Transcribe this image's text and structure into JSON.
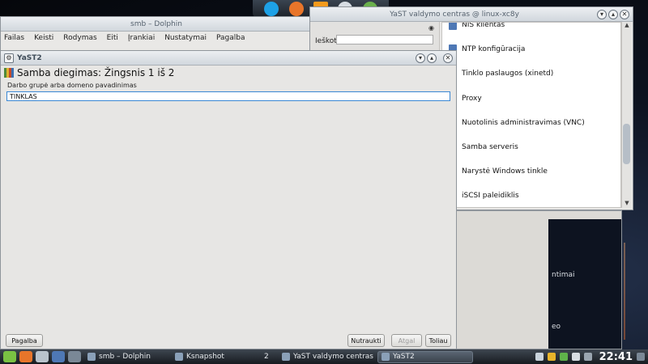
{
  "top_launcher": {
    "icons": [
      "skype-icon",
      "firefox-icon",
      "vlc-icon",
      "clock-icon",
      "app-icon"
    ]
  },
  "dolphin": {
    "title": "smb – Dolphin",
    "menu": [
      "Failas",
      "Keisti",
      "Rodymas",
      "Eiti",
      "Įrankiai",
      "Nustatymai",
      "Pagalba"
    ]
  },
  "yast_cc": {
    "title": "YaST valdymo centras @ linux-xc8y",
    "search_label": "Ieškoti",
    "search_value": "",
    "modules": [
      {
        "label": "NIS klientas"
      },
      {
        "label": "NTP konfigūracija"
      },
      {
        "label": "Tinklo paslaugos (xinetd)"
      },
      {
        "label": "Proxy"
      },
      {
        "label": "Nuotolinis administravimas (VNC)"
      },
      {
        "label": "Samba serveris"
      },
      {
        "label": "Narystė Windows tinkle"
      },
      {
        "label": "iSCSI paleidiklis"
      }
    ]
  },
  "dolphin_rest": {
    "text1": "ntimai",
    "text2": "eo"
  },
  "yast2": {
    "title": "YaST2",
    "heading": "Samba diegimas: Žingsnis 1 iš 2",
    "field_label": "Darbo grupė arba domeno pavadinimas",
    "field_value": "TINKLAS",
    "buttons": {
      "help": "Pagalba",
      "abort": "Nutraukti",
      "back": "Atgal",
      "next": "Toliau"
    }
  },
  "taskbar": {
    "tasks": [
      {
        "label": "smb – Dolphin",
        "active": false
      },
      {
        "label": "Ksnapshot",
        "active": false
      },
      {
        "label": "2",
        "active": false
      },
      {
        "label": "YaST valdymo centras @ lin",
        "active": false
      },
      {
        "label": "YaST2",
        "active": true
      }
    ],
    "clock": "22:41"
  },
  "colors": {
    "accent": "#3a87d4",
    "taskbar": "#1f252c"
  }
}
